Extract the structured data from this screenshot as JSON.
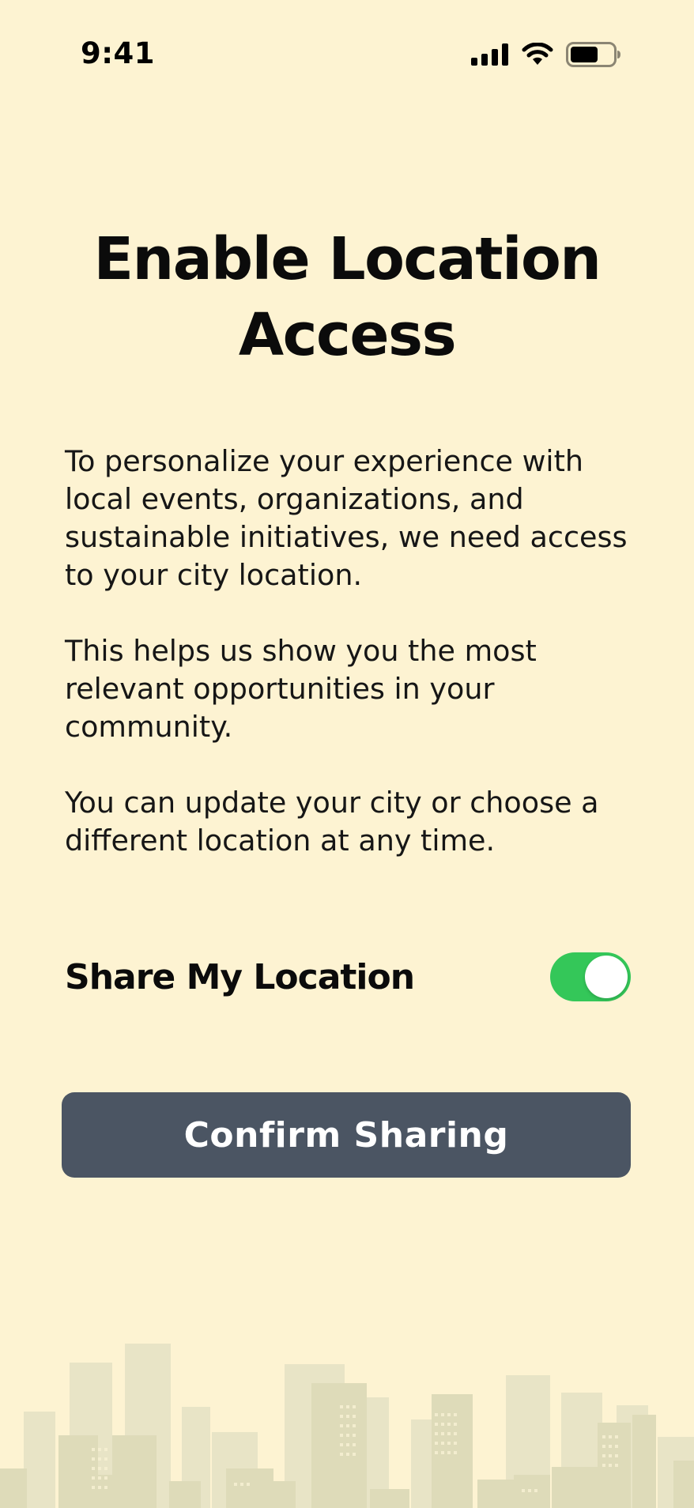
{
  "status_bar": {
    "time": "9:41",
    "icons": [
      "cellular-signal-icon",
      "wifi-icon",
      "battery-icon"
    ]
  },
  "header": {
    "title_line1": "Enable Location",
    "title_line2": "Access"
  },
  "body": {
    "paragraph1": "To personalize your experience with local events, organizations, and sustainable initiatives, we need access to your city location.",
    "paragraph2": "This helps us show you the most relevant opportunities in your community.",
    "paragraph3": "You can update your city or choose a different location at any time."
  },
  "share_setting": {
    "label": "Share My Location",
    "enabled": true
  },
  "actions": {
    "confirm_label": "Confirm Sharing"
  },
  "colors": {
    "background": "#fdf3d2",
    "toggle_on": "#34c759",
    "button": "#4b5563",
    "skyline": "#e6e3c3"
  }
}
